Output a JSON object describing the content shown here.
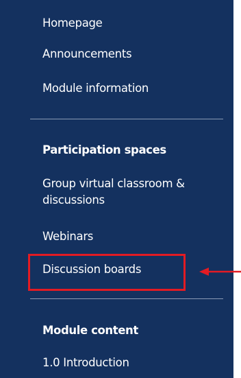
{
  "nav": {
    "items_top": [
      {
        "label": "Homepage"
      },
      {
        "label": "Announcements"
      },
      {
        "label": "Module information"
      }
    ],
    "participation": {
      "heading": "Participation spaces",
      "items": [
        {
          "label": "Group virtual classroom & discussions"
        },
        {
          "label": "Webinars"
        },
        {
          "label": "Discussion boards"
        }
      ]
    },
    "module_content": {
      "heading": "Module content",
      "items": [
        {
          "label": "1.0 Introduction"
        }
      ]
    }
  },
  "colors": {
    "panel_background": "#14315f",
    "text": "#ffffff",
    "highlight": "#e31b23"
  },
  "annotation": {
    "highlighted_item": "Discussion boards",
    "arrow_icon": "left-arrow-icon"
  }
}
